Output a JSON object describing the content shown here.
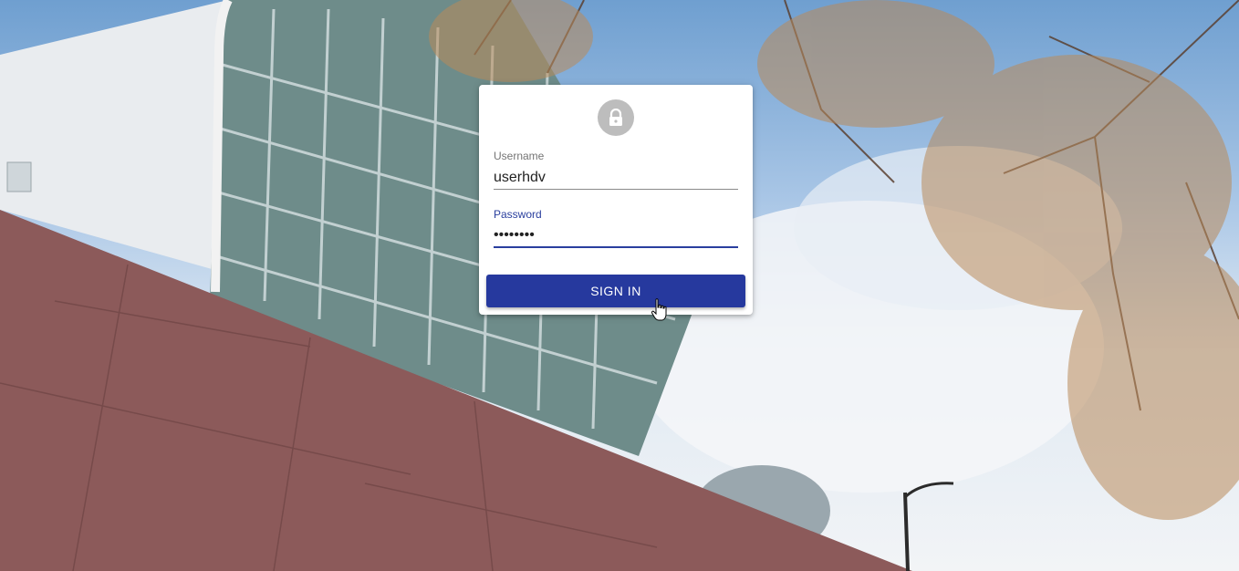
{
  "login": {
    "username_label": "Username",
    "username_value": "userhdv",
    "password_label": "Password",
    "password_value": "••••••••",
    "signin_label": "SIGN IN"
  },
  "icons": {
    "avatar": "lock-icon",
    "cursor": "hand-pointer-icon"
  },
  "colors": {
    "primary": "#26399e",
    "avatar_bg": "#bdbdbd",
    "card_bg": "#ffffff"
  }
}
